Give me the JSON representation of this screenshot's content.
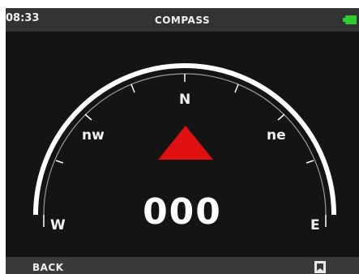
{
  "status_bar": {
    "time": "08:33",
    "title": "COMPASS",
    "battery_icon": "battery-icon",
    "battery_color": "#2ecc2e"
  },
  "compass": {
    "labels": {
      "north": "N",
      "northwest": "nw",
      "northeast": "ne",
      "west": "W",
      "east": "E"
    },
    "heading": "000",
    "pointer_icon": "triangle-pointer-icon",
    "pointer_color": "#e01010"
  },
  "bottom_bar": {
    "back_label": "BACK",
    "action_icon": "bookmark-icon"
  }
}
